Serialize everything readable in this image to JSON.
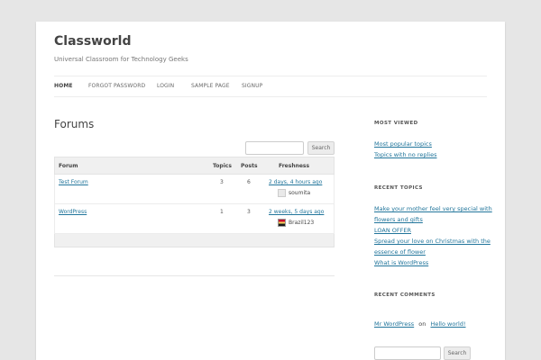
{
  "site": {
    "title": "Classworld",
    "description": "Universal Classroom for Technology Geeks"
  },
  "nav": {
    "items": [
      {
        "label": "HOME",
        "active": true
      },
      {
        "label": "FORGOT PASSWORD"
      },
      {
        "label": "LOGIN"
      },
      {
        "label": "SAMPLE PAGE"
      },
      {
        "label": "SIGNUP"
      }
    ]
  },
  "main": {
    "title": "Forums",
    "search_button": "Search",
    "table": {
      "headers": {
        "forum": "Forum",
        "topics": "Topics",
        "posts": "Posts",
        "freshness": "Freshness"
      },
      "rows": [
        {
          "forum": "Test Forum",
          "topics": "3",
          "posts": "6",
          "freshness": "2 days, 4 hours ago",
          "author": "soumita"
        },
        {
          "forum": "WordPress",
          "topics": "1",
          "posts": "3",
          "freshness": "2 weeks, 5 days ago",
          "author": "Brazil123"
        }
      ]
    }
  },
  "sidebar": {
    "most_viewed": {
      "title": "MOST VIEWED",
      "links": [
        "Most popular topics",
        "Topics with no replies"
      ]
    },
    "recent_topics": {
      "title": "RECENT TOPICS",
      "lines": [
        "Make your mother feel very special with",
        "flowers and gifts",
        "LOAN OFFER",
        "Spread your love on Christmas with the",
        "essence of flower",
        "What is WordPress"
      ]
    },
    "recent_comments": {
      "title": "RECENT COMMENTS",
      "author": "Mr WordPress",
      "on": "on",
      "post": "Hello world!"
    },
    "search_button": "Search"
  },
  "colors": {
    "link": "#21759b",
    "background": "#e6e6e6"
  }
}
